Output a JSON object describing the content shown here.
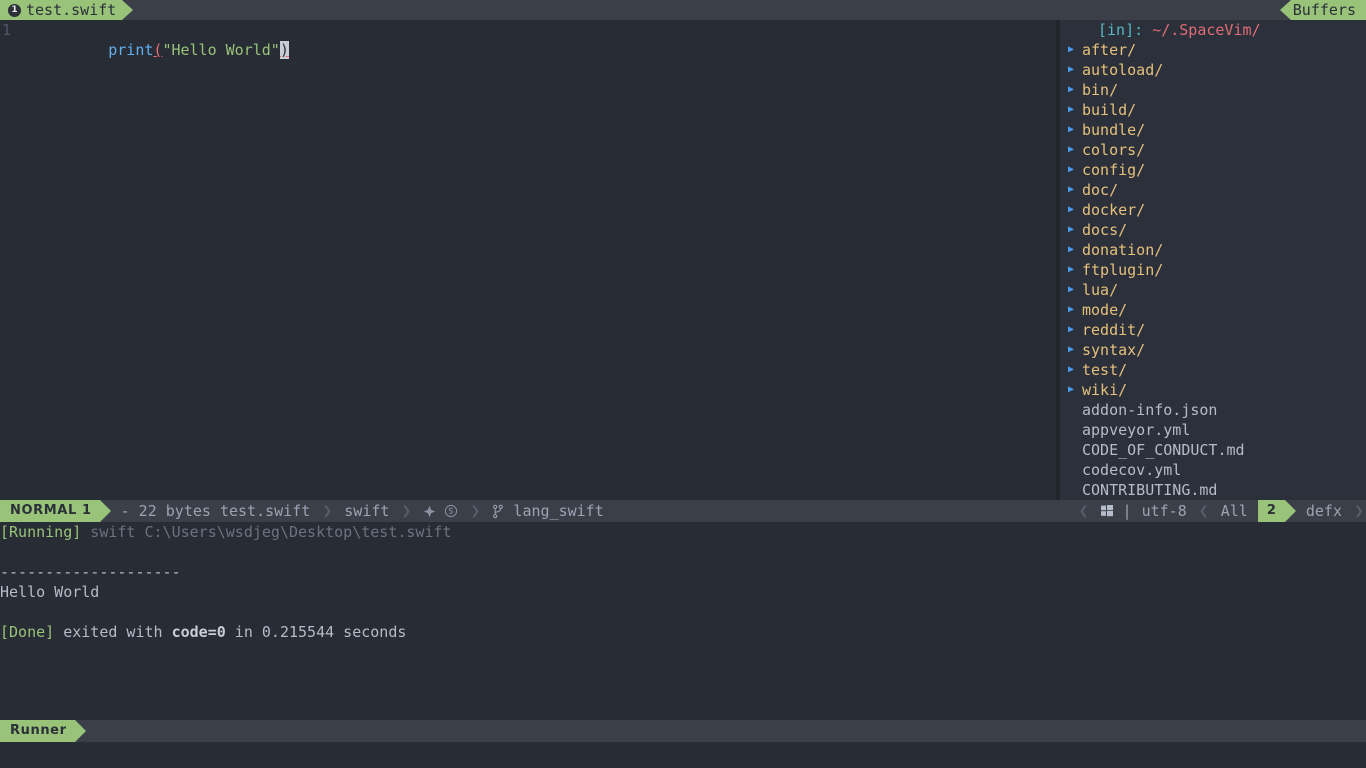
{
  "colors": {
    "accent_green": "#98c379",
    "bg_dark": "#282c34",
    "bg_panel": "#2b303b",
    "bg_statusline": "#3b4048",
    "text": "#abb2bf",
    "dir_yellow": "#e5c07b",
    "marker_blue": "#4a9cf0",
    "path_red": "#e06c75",
    "cyan": "#56b6c2"
  },
  "tabline": {
    "tab_number": "1",
    "tab_label": "test.swift",
    "buffers_label": "Buffers"
  },
  "editor": {
    "lines": [
      {
        "number": "1",
        "tokens": [
          {
            "text": "print",
            "kind": "fn"
          },
          {
            "text": "(",
            "kind": "paren-err"
          },
          {
            "text": "\"Hello World\"",
            "kind": "str"
          },
          {
            "text": ")",
            "kind": "cursor"
          }
        ]
      }
    ]
  },
  "filetree": {
    "header_prefix": "[in]:",
    "header_path": "~/.SpaceVim/",
    "marker_icon": "triangle-right-icon",
    "entries": [
      {
        "name": "after/",
        "type": "dir"
      },
      {
        "name": "autoload/",
        "type": "dir"
      },
      {
        "name": "bin/",
        "type": "dir"
      },
      {
        "name": "build/",
        "type": "dir"
      },
      {
        "name": "bundle/",
        "type": "dir"
      },
      {
        "name": "colors/",
        "type": "dir"
      },
      {
        "name": "config/",
        "type": "dir"
      },
      {
        "name": "doc/",
        "type": "dir"
      },
      {
        "name": "docker/",
        "type": "dir"
      },
      {
        "name": "docs/",
        "type": "dir"
      },
      {
        "name": "donation/",
        "type": "dir"
      },
      {
        "name": "ftplugin/",
        "type": "dir"
      },
      {
        "name": "lua/",
        "type": "dir"
      },
      {
        "name": "mode/",
        "type": "dir"
      },
      {
        "name": "reddit/",
        "type": "dir"
      },
      {
        "name": "syntax/",
        "type": "dir"
      },
      {
        "name": "test/",
        "type": "dir"
      },
      {
        "name": "wiki/",
        "type": "dir"
      },
      {
        "name": "addon-info.json",
        "type": "file"
      },
      {
        "name": "appveyor.yml",
        "type": "file"
      },
      {
        "name": "CODE_OF_CONDUCT.md",
        "type": "file"
      },
      {
        "name": "codecov.yml",
        "type": "file"
      },
      {
        "name": "CONTRIBUTING.md",
        "type": "file"
      }
    ]
  },
  "statusline": {
    "mode": "NORMAL 1",
    "file_info": "- 22 bytes test.swift",
    "filetype": "swift",
    "icon_left": "source-control-icon",
    "icon_right": "swift-logo-icon",
    "branch_icon": "git-branch-icon",
    "branch": "lang_swift",
    "os_icon": "windows-icon",
    "separator": "|",
    "encoding": "utf-8",
    "scroll": "All",
    "win_number": "2",
    "win_name": "defx"
  },
  "terminal": {
    "lines": [
      [
        {
          "text": "[Running]",
          "kind": "green"
        },
        {
          "text": " swift C:\\Users\\wsdjeg\\Desktop\\test.swift",
          "kind": "dim"
        }
      ],
      [],
      [
        {
          "text": "--------------------",
          "kind": "txt"
        }
      ],
      [
        {
          "text": "Hello World",
          "kind": "txt"
        }
      ],
      [],
      [
        {
          "text": "[Done]",
          "kind": "green"
        },
        {
          "text": " exited with ",
          "kind": "txt"
        },
        {
          "text": "code=0",
          "kind": "bold"
        },
        {
          "text": " in 0.215544 seconds",
          "kind": "txt"
        }
      ]
    ]
  },
  "bottomline": {
    "label": "Runner"
  }
}
